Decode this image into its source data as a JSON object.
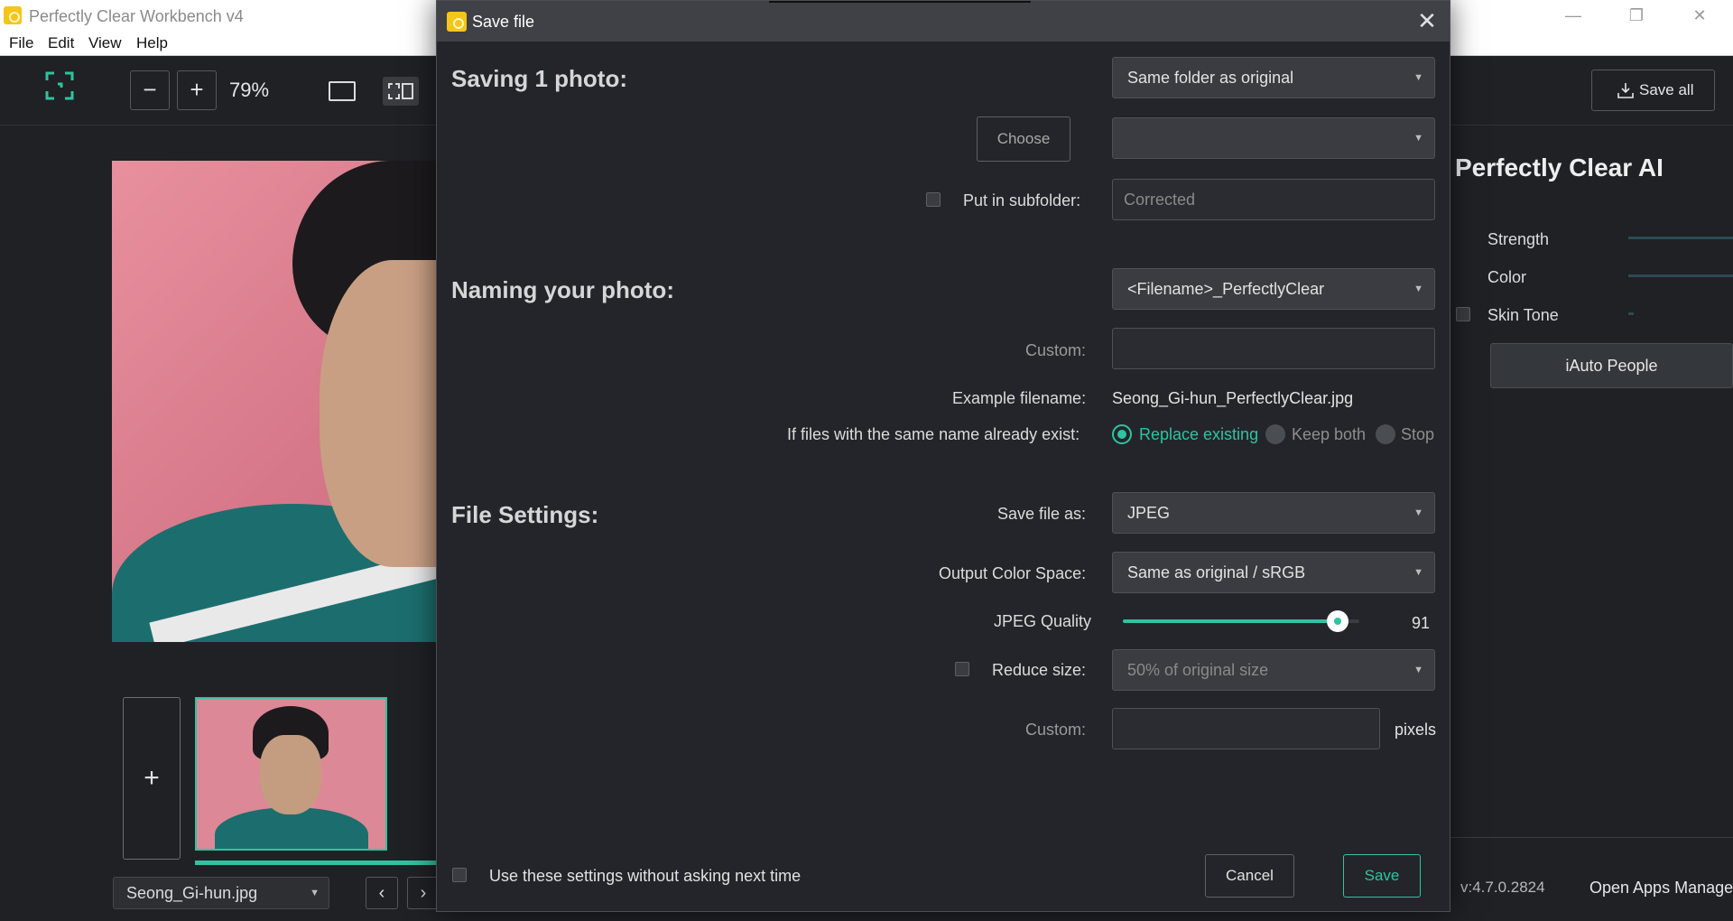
{
  "app": {
    "title": "Perfectly Clear Workbench v4",
    "menu": [
      "File",
      "Edit",
      "View",
      "Help"
    ]
  },
  "toolbar": {
    "zoom": "79%",
    "save_all_label": "Save all"
  },
  "filmstrip": {
    "add_label": "+",
    "selected_file": "Seong_Gi-hun.jpg"
  },
  "right_panel": {
    "title": "Perfectly Clear AI",
    "adjustments": [
      "Strength",
      "Color",
      "Skin Tone"
    ],
    "iauto_label": "iAuto People",
    "version": "v:4.7.0.2824",
    "open_apps": "Open Apps Manager"
  },
  "dialog": {
    "title": "Save file",
    "saving": {
      "heading": "Saving 1 photo:",
      "location": "Same folder as original",
      "choose_label": "Choose",
      "folder_value": "",
      "subfolder_label": "Put in subfolder:",
      "subfolder_value": "Corrected"
    },
    "naming": {
      "heading": "Naming your photo:",
      "pattern": "<Filename>_PerfectlyClear",
      "custom_label": "Custom:",
      "custom_value": "",
      "example_label": "Example filename:",
      "example_value": "Seong_Gi-hun_PerfectlyClear.jpg",
      "exists_label": "If files with the same name already exist:",
      "options": [
        "Replace existing",
        "Keep both",
        "Stop"
      ],
      "selected_option": "Replace existing"
    },
    "file_settings": {
      "heading": "File Settings:",
      "save_as_label": "Save file as:",
      "save_as_value": "JPEG",
      "color_space_label": "Output Color Space:",
      "color_space_value": "Same as original / sRGB",
      "quality_label": "JPEG Quality",
      "quality_value": "91",
      "quality_level": 91,
      "reduce_label": "Reduce size:",
      "reduce_value": "50% of original size",
      "custom_label": "Custom:",
      "custom_value": "",
      "pixels_label": "pixels"
    },
    "footer": {
      "remember_label": "Use these settings without asking next time",
      "cancel_label": "Cancel",
      "save_label": "Save"
    }
  },
  "colors": {
    "accent": "#2ec4a1",
    "background": "#1f2125",
    "dialog_bg": "#23252a"
  }
}
